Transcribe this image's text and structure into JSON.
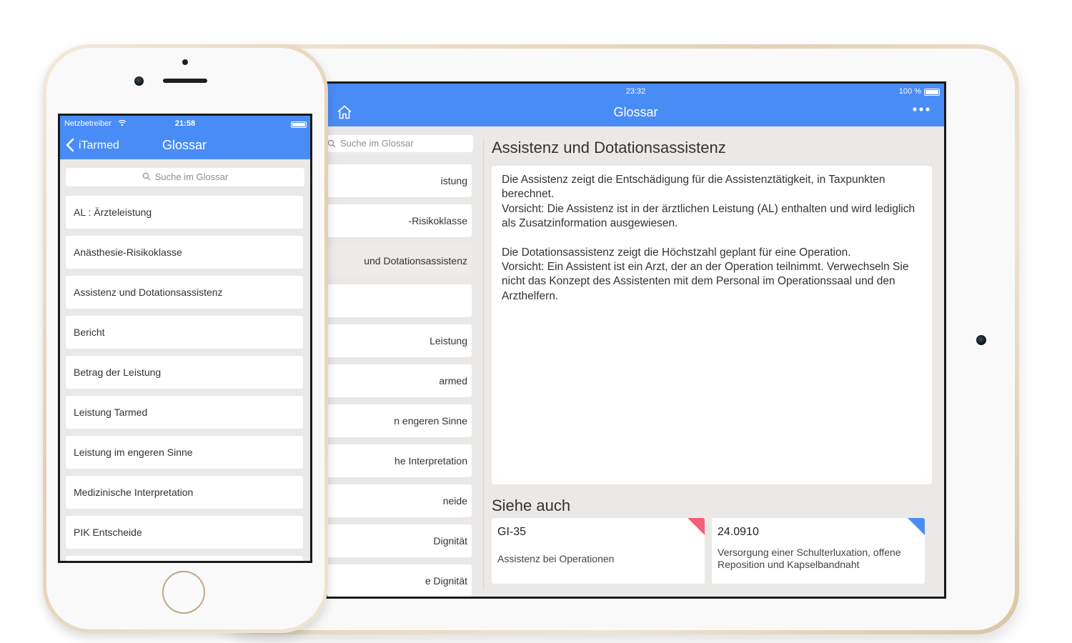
{
  "ipad": {
    "status": {
      "time": "23:32",
      "battery": "100 %"
    },
    "nav": {
      "title": "Glossar"
    },
    "search": {
      "placeholder": "Suche im Glossar"
    },
    "list": [
      {
        "label": "istung",
        "selected": false
      },
      {
        "label": "-Risikoklasse",
        "selected": false
      },
      {
        "label": "und Dotationsassistenz",
        "selected": true
      },
      {
        "label": "",
        "selected": false
      },
      {
        "label": "Leistung",
        "selected": false
      },
      {
        "label": "armed",
        "selected": false
      },
      {
        "label": "n engeren Sinne",
        "selected": false
      },
      {
        "label": "he Interpretation",
        "selected": false
      },
      {
        "label": "neide",
        "selected": false
      },
      {
        "label": "Dignität",
        "selected": false
      },
      {
        "label": "e Dignität",
        "selected": false
      }
    ],
    "detail": {
      "title": "Assistenz und Dotationsassistenz",
      "para1_line1": "Die Assistenz zeigt die Entschädigung für die Assistenztätigkeit, in Taxpunkten berechnet.",
      "para1_line2": "Vorsicht: Die Assistenz ist in der ärztlichen Leistung (AL) enthalten und wird lediglich als Zusatzinformation ausgewiesen.",
      "para2_line1": "Die Dotationsassistenz zeigt die Höchstzahl geplant für eine Operation.",
      "para2_line2": "Vorsicht: Ein Assistent ist ein Arzt, der an der Operation teilnimmt. Verwechseln Sie nicht das Konzept des Assistenten mit dem Personal im Operationssaal und den Arzthelfern."
    },
    "see_also": {
      "title": "Siehe auch",
      "cards": [
        {
          "code": "GI-35",
          "description": "Assistenz bei Operationen",
          "corner_color": "#f2607a"
        },
        {
          "code": "24.0910",
          "description": "Versorgung einer Schulterluxation, offene Reposition und Kapselbandnaht",
          "corner_color": "#4a8cf6"
        }
      ]
    }
  },
  "iphone": {
    "status": {
      "carrier": "Netzbetreiber",
      "time": "21:58"
    },
    "nav": {
      "back_label": "iTarmed",
      "title": "Glossar"
    },
    "search": {
      "placeholder": "Suche im Glossar"
    },
    "list": [
      "AL : Ärzteleistung",
      "Anästhesie-Risikoklasse",
      "Assistenz und Dotationsassistenz",
      "Bericht",
      "Betrag der Leistung",
      "Leistung Tarmed",
      "Leistung im engeren Sinne",
      "Medizinische Interpretation",
      "PIK Entscheide",
      ""
    ]
  },
  "colors": {
    "nav_blue": "#4a8cf6",
    "background": "#ebe9e7",
    "device_gold": "#e3d2b6"
  },
  "icons": [
    "home-icon",
    "more-icon",
    "search-icon",
    "wifi-icon",
    "back-chevron-icon",
    "battery-icon"
  ]
}
